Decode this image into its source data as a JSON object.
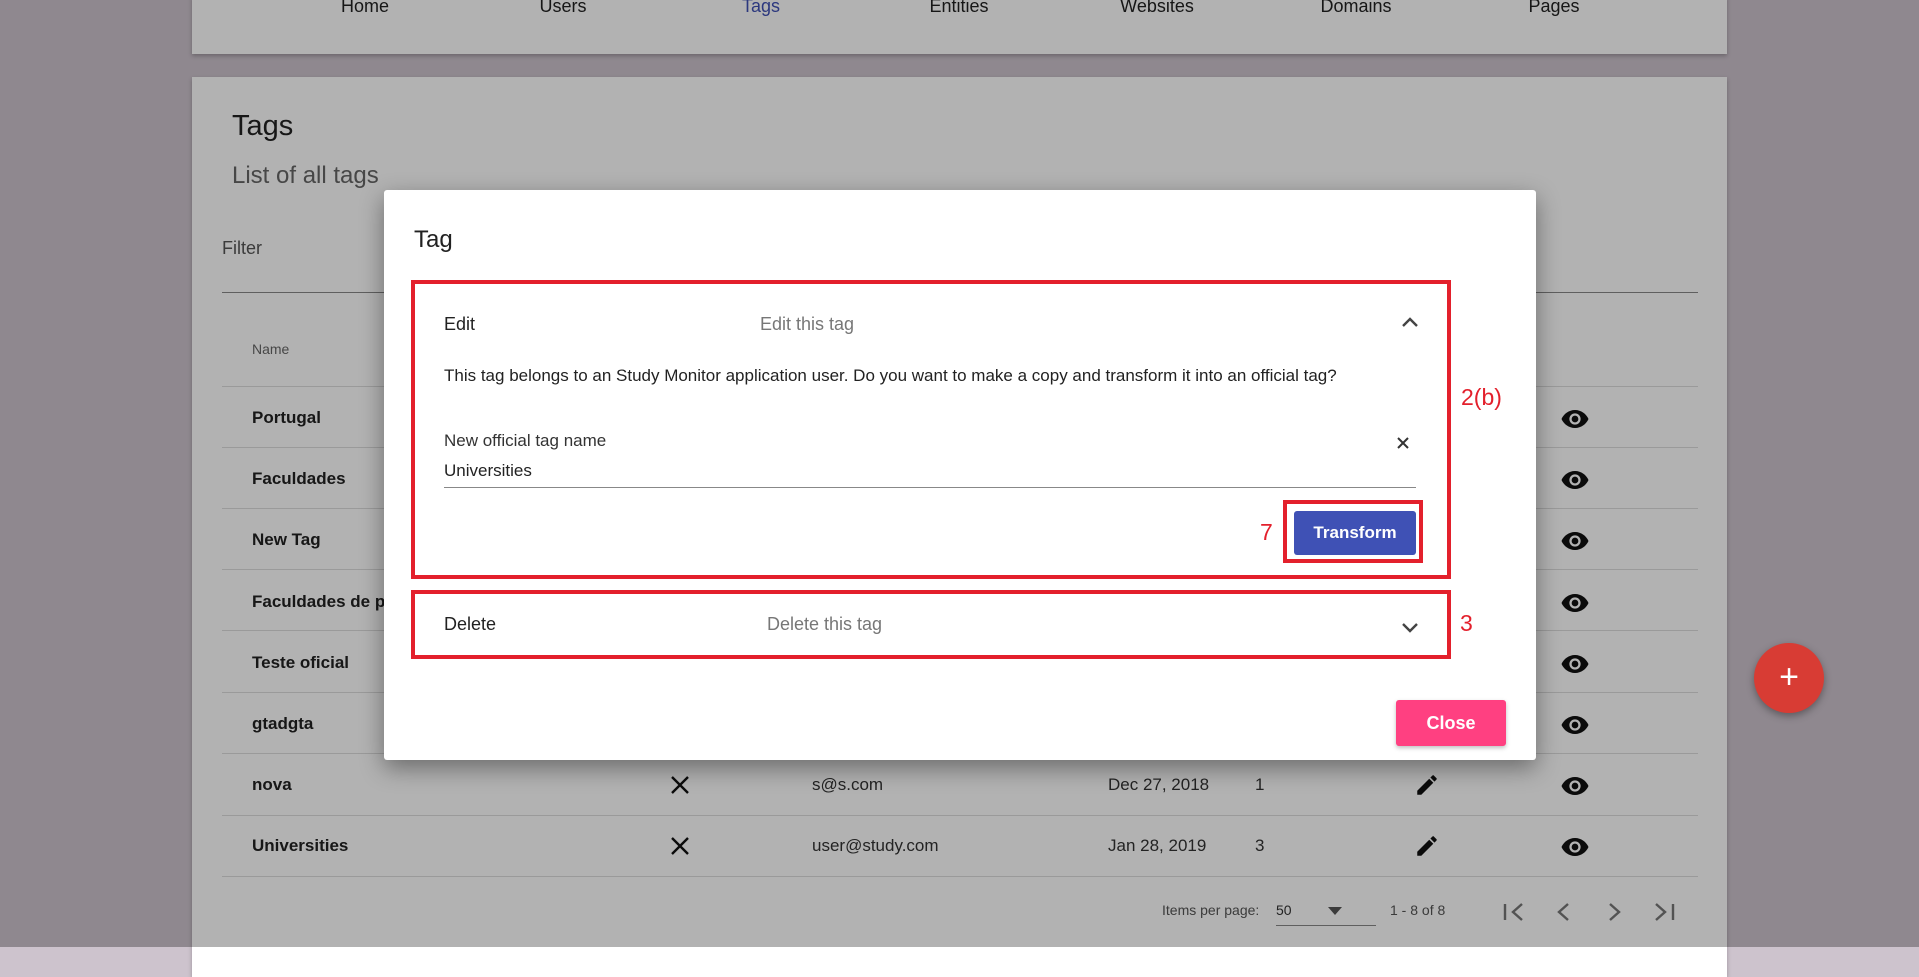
{
  "nav": {
    "items": [
      {
        "label": "Home"
      },
      {
        "label": "Users"
      },
      {
        "label": "Tags"
      },
      {
        "label": "Entities"
      },
      {
        "label": "Websites"
      },
      {
        "label": "Domains"
      },
      {
        "label": "Pages"
      }
    ],
    "active": "Tags",
    "active_color": "#3f51b5"
  },
  "page": {
    "title": "Tags",
    "subtitle": "List of all tags",
    "filter_label": "Filter",
    "column_name": "Name"
  },
  "table": {
    "rows": [
      {
        "name": "Portugal"
      },
      {
        "name": "Faculdades"
      },
      {
        "name": "New Tag"
      },
      {
        "name": "Faculdades de po"
      },
      {
        "name": "Teste oficial"
      },
      {
        "name": "gtadgta"
      },
      {
        "name": "nova",
        "email": "s@s.com",
        "date": "Dec 27, 2018",
        "count": "1"
      },
      {
        "name": "Universities",
        "email": "user@study.com",
        "date": "Jan 28, 2019",
        "count": "3"
      }
    ]
  },
  "paginator": {
    "items_per_page_label": "Items per page:",
    "page_size": "50",
    "range": "1 - 8 of 8"
  },
  "fab": {
    "label": "+"
  },
  "dialog": {
    "title": "Tag",
    "edit": {
      "title": "Edit",
      "description": "Edit this tag",
      "message": "This tag belongs to an Study Monitor application user. Do you want to make a copy and transform it into an official tag?",
      "field_label": "New official tag name",
      "field_value": "Universities",
      "transform_label": "Transform"
    },
    "delete": {
      "title": "Delete",
      "description": "Delete this tag"
    },
    "close_label": "Close"
  },
  "annotations": {
    "edit_panel": "2(b)",
    "transform_button": "7",
    "delete_panel": "3",
    "color": "#e3202c"
  },
  "colors": {
    "primary": "#3f51b5",
    "accent": "#ff4081",
    "fab": "#d83c34"
  }
}
